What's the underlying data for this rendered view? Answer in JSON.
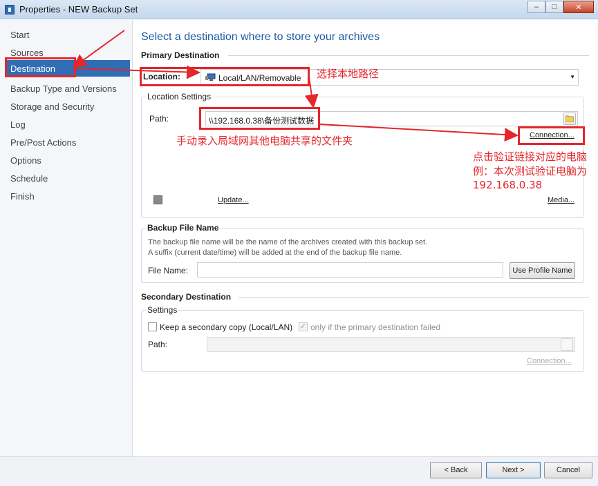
{
  "window": {
    "title": "Properties - NEW Backup Set",
    "buttons": {
      "minimize": "–",
      "maximize": "□",
      "close": "✕"
    }
  },
  "sidebar": {
    "items": [
      {
        "label": "Start"
      },
      {
        "label": "Sources"
      },
      {
        "label": "Destination",
        "active": true
      },
      {
        "label": "Backup Type and Versions"
      },
      {
        "label": "Storage and Security"
      },
      {
        "label": "Log"
      },
      {
        "label": "Pre/Post Actions"
      },
      {
        "label": "Options"
      },
      {
        "label": "Schedule"
      },
      {
        "label": "Finish"
      }
    ]
  },
  "main": {
    "heading": "Select a destination where to store your archives",
    "primary": {
      "title": "Primary Destination",
      "location_label": "Location:",
      "location_value": "Local/LAN/Removable",
      "settings_title": "Location Settings",
      "path_label": "Path:",
      "path_value": "\\\\192.168.0.38\\备份测试数据",
      "connection_link": "Connection...",
      "update_link": "Update...",
      "media_link": "Media..."
    },
    "backup_file": {
      "title": "Backup File Name",
      "desc1": "The backup file name will be the name of the archives created with this backup set.",
      "desc2": "A suffix (current date/time) will be added at the end of the backup file name.",
      "file_name_label": "File Name:",
      "file_name_value": "",
      "use_profile_button": "Use Profile Name"
    },
    "secondary": {
      "title": "Secondary Destination",
      "settings_title": "Settings",
      "keep_copy_label": "Keep a secondary copy (Local/LAN)",
      "only_if_failed_label": "only if the primary destination failed",
      "path_label": "Path:",
      "path_value": "",
      "connection_link": "Connection..."
    }
  },
  "footer": {
    "back": "< Back",
    "next": "Next >",
    "cancel": "Cancel"
  },
  "annotations": {
    "select_local": "选择本地路径",
    "manual_input": "手动录入局域网其他电脑共享的文件夹",
    "verify_line1": "点击验证链接对应的电脑",
    "verify_line2": "例：本次测试验证电脑为",
    "verify_line3": "192.168.0.38",
    "color": "#e5262b"
  }
}
